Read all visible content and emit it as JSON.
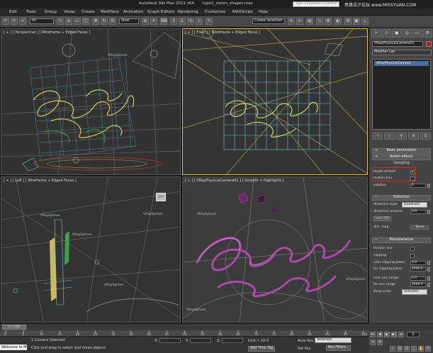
{
  "title_bar": {
    "app_title": "Autodesk 3ds Max  2011 x64",
    "file_name": "type1_colors_shapes.max",
    "search_placeholder": "Type a keyword or phrase",
    "watermark": "思缘设计论坛 www.MISSYUAN.COM"
  },
  "menu": [
    "Edit",
    "Tools",
    "Group",
    "Views",
    "Create",
    "Modifiers",
    "Animation",
    "Graph Editors",
    "Rendering",
    "Customize",
    "MAXScript",
    "Help"
  ],
  "toolbar": {
    "selection_filter": "All",
    "ref_coord": "View",
    "named_selection": "Create Selection"
  },
  "viewports": {
    "top_left": {
      "label": "[ + ] [ Perspective ] [ Wireframe + Edged Faces ]"
    },
    "top_right": {
      "label": "[ + ] [ Front ] [ Wireframe + Edged Faces ]"
    },
    "bottom_left": {
      "label": "[ + ] [ Left ] [ Wireframe + Edged Faces ]"
    },
    "bottom_right": {
      "label": "[ + ] [ VRayPhysicalCamera01 ] [ Smooth + Highlights ]"
    },
    "sphere_label": "VRaySphere",
    "cube_label": "LEFT"
  },
  "command_panel": {
    "tabs": [
      "+",
      "◇",
      "▣",
      "◎",
      "▭",
      "⚙"
    ],
    "object_name": "VRayPhysicalCamera01",
    "modifier_list": "Modifier List",
    "stack_item": "VRayPhysicalCamera",
    "stack_buttons": [
      "⊣",
      "|",
      "∀",
      "⊘",
      "⊡"
    ],
    "basic_params": "Basic parameters",
    "bokeh": "Bokeh effects",
    "sampling": "Sampling",
    "depth_of_field": "depth-of-field",
    "motion_blur": "motion blur",
    "subdivs": "subdivs",
    "subdivs_value": "6",
    "distortion": "Distortion",
    "distortion_type": "distortion type",
    "distortion_type_value": "Quadratic",
    "distortion_amount": "distortion amount",
    "distortion_amount_value": "0.0",
    "lens_file": "Lens file",
    "dist_map": "dist. map",
    "dist_map_value": "None",
    "miscellaneous": "Miscellaneous",
    "horizon_line": "horizon line",
    "clipping": "clipping",
    "near_clip": "near clipping plane",
    "near_clip_value": "0.0",
    "far_clip": "far clipping plane",
    "far_clip_value": "1000.0",
    "near_env": "near env range",
    "near_env_value": "0.0",
    "far_env": "far env range",
    "far_env_value": "1000.0",
    "show_cone": "show cone",
    "show_cone_value": "Selected"
  },
  "timeline": {
    "frame_display": "0 / 100",
    "ticks": [
      "0",
      "5",
      "10",
      "15",
      "20",
      "25",
      "30",
      "35",
      "40",
      "45",
      "50",
      "55",
      "60",
      "65",
      "70",
      "75",
      "80",
      "85",
      "90",
      "95",
      "100"
    ]
  },
  "status": {
    "maxscript": "Welcome to M",
    "selection": "1 Camera Selected",
    "prompt": "Click and drag to select and move objects",
    "x_label": "X:",
    "y_label": "Y:",
    "z_label": "Z:",
    "grid": "Grid = 10.0",
    "add_time_tag": "Add Time Tag",
    "auto_key": "Auto Key",
    "selected": "Selected",
    "set_key": "Set Key",
    "key_filters": "Key Filters...",
    "frame": "0"
  },
  "colors": {
    "active_border": "#e7c83e",
    "highlight_red": "#d22222",
    "stack_selected": "#4d6b96",
    "wire_cyan": "#6fc7d6",
    "wire_yellow": "#d8c866",
    "text_magenta": "#b24bb0"
  }
}
